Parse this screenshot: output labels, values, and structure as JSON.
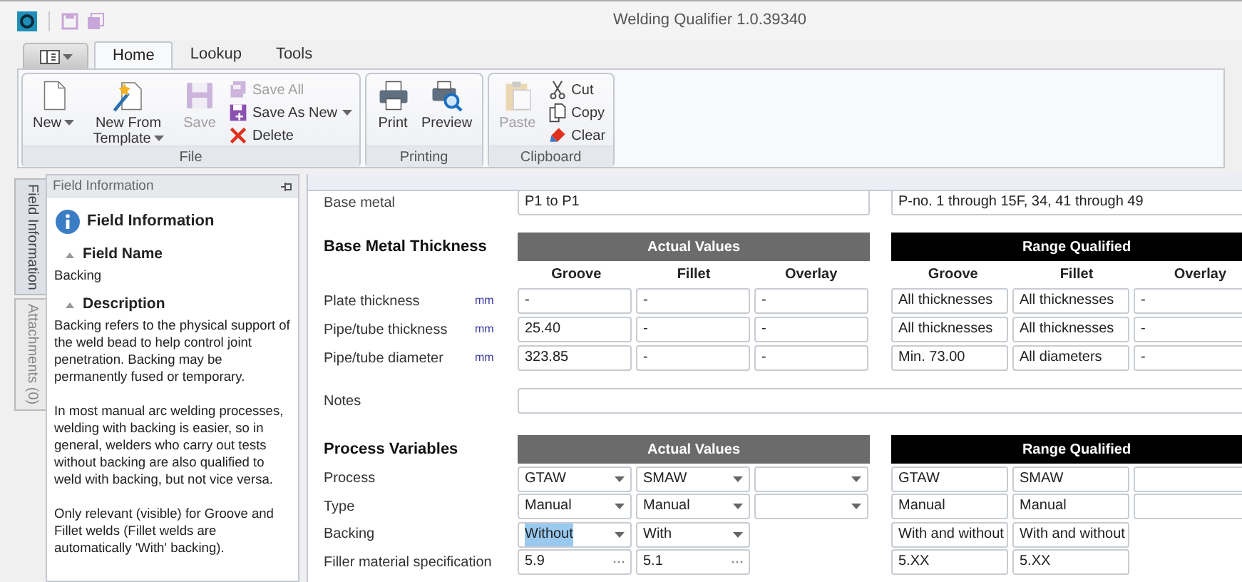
{
  "window": {
    "title": "Welding Qualifier 1.0.39340"
  },
  "ribbon": {
    "tabs": [
      {
        "label": "Home",
        "selected": true
      },
      {
        "label": "Lookup",
        "selected": false
      },
      {
        "label": "Tools",
        "selected": false
      }
    ],
    "groups": [
      {
        "label": "File",
        "items": [
          {
            "kind": "large",
            "label": "New",
            "dropdown": true,
            "disabled": false
          },
          {
            "kind": "large",
            "label": "New From Template",
            "dropdown": true,
            "disabled": false
          },
          {
            "kind": "large",
            "label": "Save",
            "dropdown": false,
            "disabled": true
          },
          {
            "kind": "small",
            "label": "Save All",
            "dropdown": false,
            "disabled": true
          },
          {
            "kind": "small",
            "label": "Save As New",
            "dropdown": true,
            "disabled": false
          },
          {
            "kind": "small",
            "label": "Delete",
            "dropdown": false,
            "disabled": false
          }
        ]
      },
      {
        "label": "Printing",
        "items": [
          {
            "kind": "large",
            "label": "Print",
            "dropdown": false,
            "disabled": false
          },
          {
            "kind": "large",
            "label": "Preview",
            "dropdown": false,
            "disabled": false
          }
        ]
      },
      {
        "label": "Clipboard",
        "items": [
          {
            "kind": "large",
            "label": "Paste",
            "dropdown": false,
            "disabled": true
          },
          {
            "kind": "small",
            "label": "Cut",
            "dropdown": false,
            "disabled": false
          },
          {
            "kind": "small",
            "label": "Copy",
            "dropdown": false,
            "disabled": false
          },
          {
            "kind": "small",
            "label": "Clear",
            "dropdown": false,
            "disabled": false
          }
        ]
      }
    ]
  },
  "side_tabs": [
    {
      "label": "Field Information",
      "selected": true
    },
    {
      "label": "Attachments (0)",
      "selected": false
    }
  ],
  "field_info": {
    "panel_title": "Field Information",
    "heading": "Field Information",
    "sections": [
      {
        "title": "Field Name",
        "paragraphs": [
          "Backing"
        ]
      },
      {
        "title": "Description",
        "paragraphs": [
          "Backing refers to the physical support of the weld bead to help control joint penetration. Backing may be permanently fused or temporary.",
          "In most manual arc welding processes, welding with backing is easier, so in general, welders who carry out tests without backing are also qualified to weld with backing, but not vice versa.",
          "Only relevant (visible) for Groove and Fillet welds (Fillet welds are automatically 'With' backing)."
        ]
      }
    ]
  },
  "form": {
    "base_metal": {
      "label": "Base metal",
      "actual": "P1 to P1",
      "range": "P-no. 1 through 15F, 34, 41 through 49"
    },
    "thickness": {
      "title": "Base Metal Thickness",
      "actual_header": "Actual Values",
      "range_header": "Range Qualified",
      "actual_columns": [
        "Groove",
        "Fillet",
        "Overlay"
      ],
      "range_columns": [
        "Groove",
        "Fillet",
        "Overlay"
      ],
      "rows": [
        {
          "label": "Plate thickness",
          "unit": "mm",
          "actual": [
            "-",
            "-",
            "-"
          ],
          "range": [
            "All thicknesses",
            "All thicknesses",
            "-"
          ]
        },
        {
          "label": "Pipe/tube thickness",
          "unit": "mm",
          "actual": [
            "25.40",
            "-",
            "-"
          ],
          "range": [
            "All thicknesses",
            "All thicknesses",
            "-"
          ]
        },
        {
          "label": "Pipe/tube diameter",
          "unit": "mm",
          "actual": [
            "323.85",
            "-",
            "-"
          ],
          "range": [
            "Min. 73.00",
            "All diameters",
            "-"
          ]
        }
      ]
    },
    "notes": {
      "label": "Notes"
    },
    "process": {
      "title": "Process Variables",
      "actual_header": "Actual Values",
      "range_header": "Range Qualified",
      "rows": [
        {
          "label": "Process",
          "actual": [
            {
              "kind": "select",
              "value": "GTAW",
              "highlighted": false
            },
            {
              "kind": "select",
              "value": "SMAW",
              "highlighted": false
            },
            {
              "kind": "select"
            }
          ],
          "range": [
            {
              "kind": "text",
              "value": "GTAW"
            },
            {
              "kind": "text",
              "value": "SMAW"
            },
            {
              "kind": "text"
            }
          ]
        },
        {
          "label": "Type",
          "actual": [
            {
              "kind": "select",
              "value": "Manual",
              "highlighted": false
            },
            {
              "kind": "select",
              "value": "Manual",
              "highlighted": false
            },
            {
              "kind": "select"
            }
          ],
          "range": [
            {
              "kind": "text",
              "value": "Manual"
            },
            {
              "kind": "text",
              "value": "Manual"
            },
            {
              "kind": "text"
            }
          ]
        },
        {
          "label": "Backing",
          "actual": [
            {
              "kind": "select",
              "value": "Without",
              "highlighted": true
            },
            {
              "kind": "select",
              "value": "With",
              "highlighted": false
            }
          ],
          "range": [
            {
              "kind": "text",
              "value": "With and without"
            },
            {
              "kind": "text",
              "value": "With and without"
            }
          ]
        },
        {
          "label": "Filler material specification",
          "actual": [
            {
              "kind": "browse",
              "value": "5.9",
              "highlighted": false
            },
            {
              "kind": "browse",
              "value": "5.1",
              "highlighted": false
            }
          ],
          "range": [
            {
              "kind": "text",
              "value": "5.XX"
            },
            {
              "kind": "text",
              "value": "5.XX"
            }
          ]
        }
      ]
    }
  }
}
